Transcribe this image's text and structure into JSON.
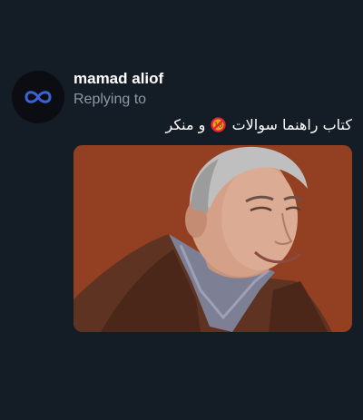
{
  "tweet": {
    "author": {
      "display_name": "mamad aliof",
      "avatar_icon": "infinity-icon",
      "avatar_accent": "#3b63d6"
    },
    "reply_context": "Replying to",
    "text_before_emoji": "کتاب راهنما سوالات",
    "emoji": "no-entry-prohibited-icon",
    "text_after_emoji": "و منکر",
    "media": {
      "type": "photo",
      "subject": "smiling man in brown leather jacket",
      "dominant_colors": [
        "#9a4526",
        "#5a3424",
        "#cfcfcf"
      ]
    }
  },
  "colors": {
    "background": "#141d26",
    "primary_text": "#ffffff",
    "secondary_text": "#8b98a5"
  }
}
